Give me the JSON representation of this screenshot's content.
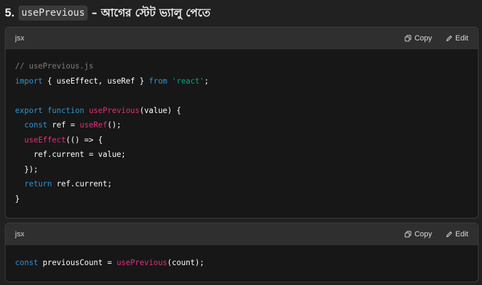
{
  "heading": {
    "number": "5.",
    "code": "usePrevious",
    "title": "– আগের স্টেট ভ্যালু পেতে"
  },
  "blocks": [
    {
      "language": "jsx",
      "copy_label": "Copy",
      "edit_label": "Edit",
      "lines": [
        [
          {
            "t": "// usePrevious.js",
            "c": "cm"
          }
        ],
        [
          {
            "t": "import",
            "c": "kw"
          },
          {
            "t": " { useEffect, useRef } ",
            "c": "pl"
          },
          {
            "t": "from",
            "c": "kw"
          },
          {
            "t": " ",
            "c": "pl"
          },
          {
            "t": "'react'",
            "c": "str"
          },
          {
            "t": ";",
            "c": "pl"
          }
        ],
        [],
        [
          {
            "t": "export",
            "c": "kw"
          },
          {
            "t": " ",
            "c": "pl"
          },
          {
            "t": "function",
            "c": "kw"
          },
          {
            "t": " ",
            "c": "pl"
          },
          {
            "t": "usePrevious",
            "c": "fn"
          },
          {
            "t": "(value) {",
            "c": "pl"
          }
        ],
        [
          {
            "t": "  ",
            "c": "pl"
          },
          {
            "t": "const",
            "c": "kw"
          },
          {
            "t": " ref = ",
            "c": "pl"
          },
          {
            "t": "useRef",
            "c": "fn"
          },
          {
            "t": "();",
            "c": "pl"
          }
        ],
        [
          {
            "t": "  ",
            "c": "pl"
          },
          {
            "t": "useEffect",
            "c": "fn"
          },
          {
            "t": "(() => {",
            "c": "pl"
          }
        ],
        [
          {
            "t": "    ref.current = value;",
            "c": "pl"
          }
        ],
        [
          {
            "t": "  });",
            "c": "pl"
          }
        ],
        [
          {
            "t": "  ",
            "c": "pl"
          },
          {
            "t": "return",
            "c": "kw"
          },
          {
            "t": " ref.current;",
            "c": "pl"
          }
        ],
        [
          {
            "t": "}",
            "c": "pl"
          }
        ]
      ]
    },
    {
      "language": "jsx",
      "copy_label": "Copy",
      "edit_label": "Edit",
      "lines": [
        [
          {
            "t": "const",
            "c": "kw"
          },
          {
            "t": " previousCount = ",
            "c": "pl"
          },
          {
            "t": "usePrevious",
            "c": "fn"
          },
          {
            "t": "(count);",
            "c": "pl"
          }
        ]
      ]
    }
  ]
}
